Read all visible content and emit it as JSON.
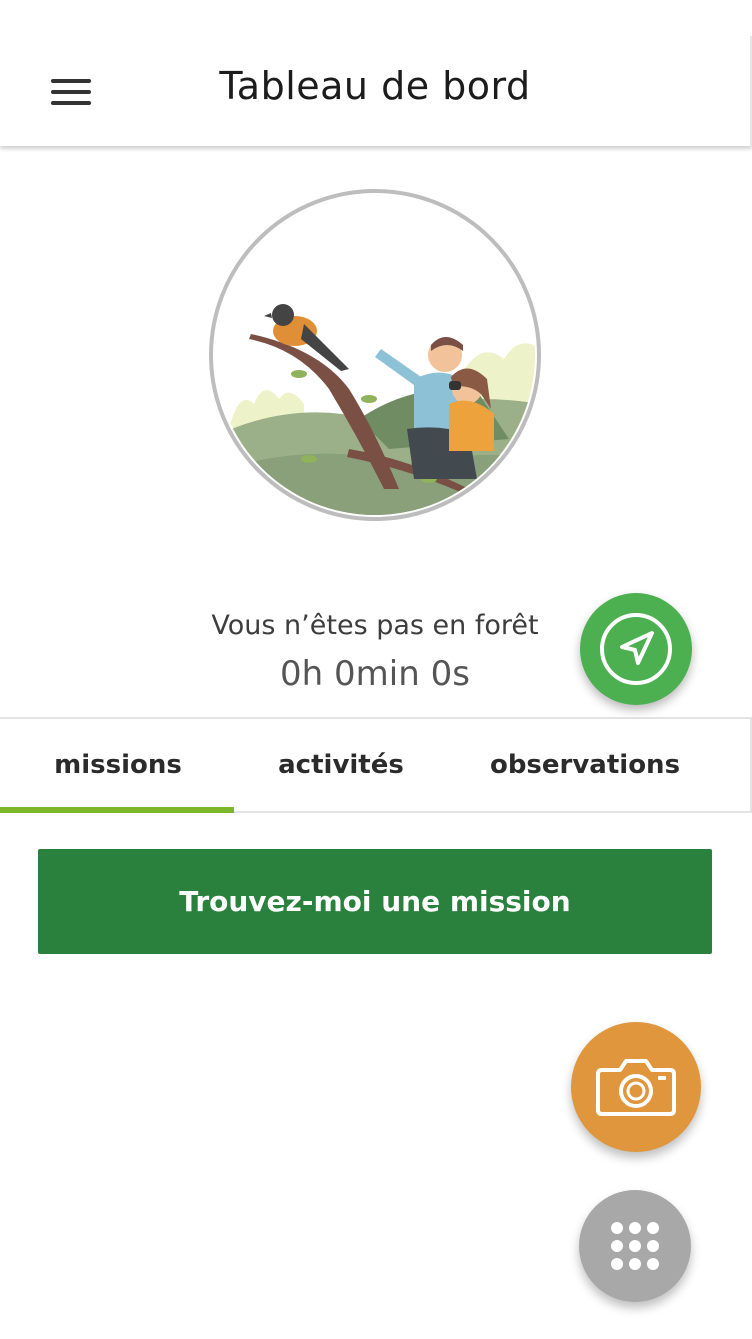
{
  "header": {
    "title": "Tableau de bord",
    "menu_icon": "hamburger-menu-icon"
  },
  "illustration": {
    "description_icon": "birdwatching-illustration"
  },
  "status": {
    "location_text": "Vous n’êtes pas en forêt",
    "timer": "0h 0min 0s"
  },
  "tabs": [
    {
      "label": "missions",
      "active": true
    },
    {
      "label": "activités",
      "active": false
    },
    {
      "label": "observations",
      "active": false
    }
  ],
  "main": {
    "cta_label": "Trouvez-moi une mission"
  },
  "fabs": {
    "navigation_icon": "navigation-arrow-icon",
    "camera_icon": "camera-icon",
    "grid_icon": "grid-dots-icon"
  },
  "colors": {
    "accent_green": "#4cb050",
    "cta_green": "#2a803d",
    "tab_underline": "#7cb72b",
    "camera_orange": "#df963c",
    "grid_gray": "#a8a8a8"
  }
}
